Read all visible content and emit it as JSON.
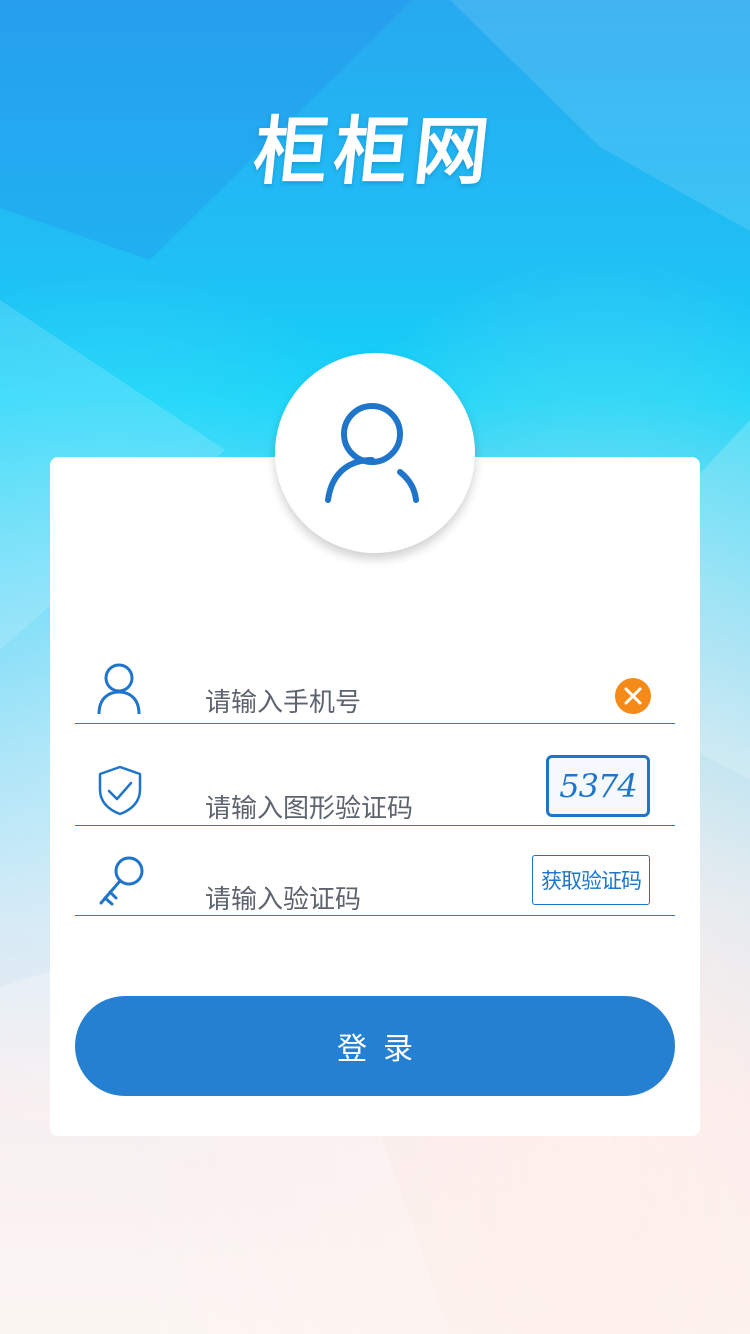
{
  "app": {
    "logo_text": "柜柜网"
  },
  "colors": {
    "accent": "#2680d2",
    "clear_button": "#f48a17",
    "underline": "#2b7dd0"
  },
  "form": {
    "phone": {
      "placeholder": "请输入手机号",
      "icon": "user-icon",
      "clear_icon": "close-icon"
    },
    "captcha": {
      "placeholder": "请输入图形验证码",
      "icon": "shield-check-icon",
      "captcha_text": "5374"
    },
    "sms_code": {
      "placeholder": "请输入验证码",
      "icon": "key-icon",
      "get_code_label": "获取验证码"
    },
    "login_label": "登录"
  },
  "avatar": {
    "icon": "user-avatar-icon"
  }
}
